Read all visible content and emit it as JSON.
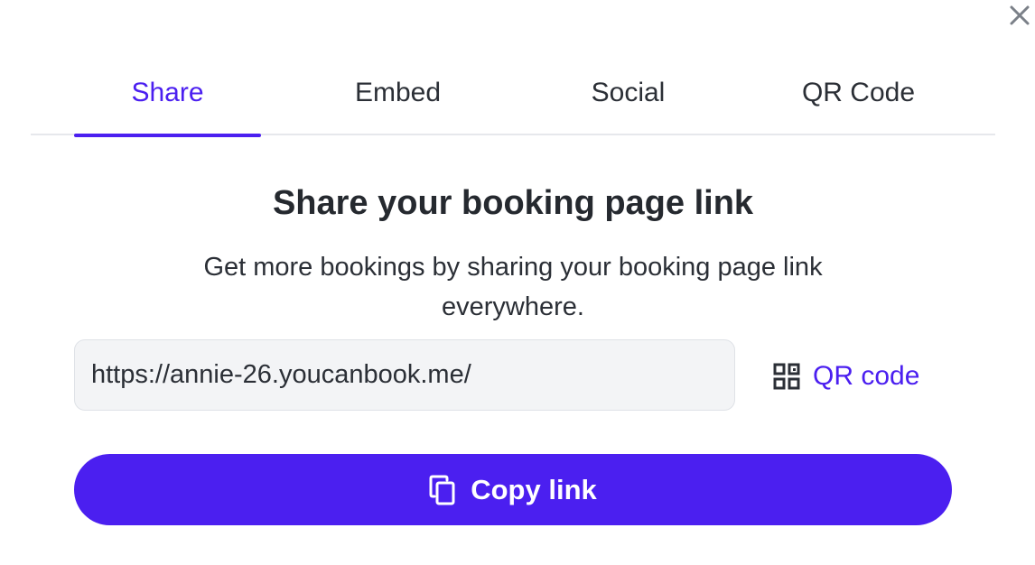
{
  "close": {
    "icon": "close-icon"
  },
  "tabs": [
    {
      "label": "Share",
      "active": true
    },
    {
      "label": "Embed",
      "active": false
    },
    {
      "label": "Social",
      "active": false
    },
    {
      "label": "QR Code",
      "active": false
    }
  ],
  "share": {
    "heading": "Share your booking page link",
    "subtext": "Get more bookings by sharing your booking page link everywhere.",
    "link_value": "https://annie-26.youcanbook.me/",
    "qr_icon": "qr-code-icon",
    "qr_label": "QR code",
    "copy_icon": "copy-icon",
    "copy_label": "Copy link"
  },
  "colors": {
    "accent": "#4b1ff0",
    "text": "#2b2f36",
    "field_bg": "#f3f4f6",
    "divider": "#e6e8ec"
  }
}
